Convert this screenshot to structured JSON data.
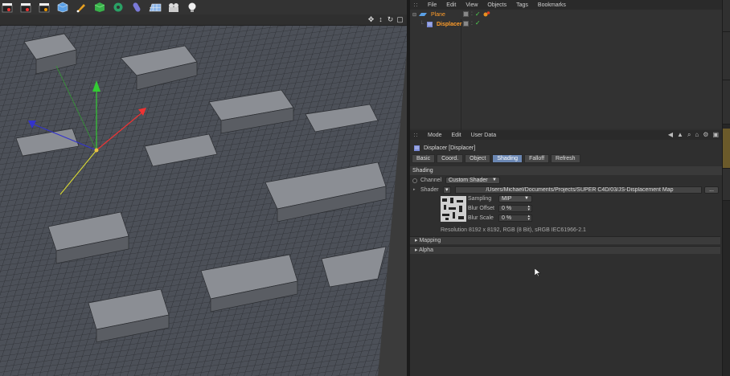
{
  "viewport": {
    "toolbar_icons": [
      "clapper-icon",
      "clapper-record-icon",
      "clapper-settings-icon",
      "cube-icon",
      "pen-icon",
      "cube-green-icon",
      "gear-green-icon",
      "capsule-icon",
      "grid-icon",
      "camera-icon",
      "light-icon"
    ],
    "nav_icons": [
      "move-icon",
      "zoom-icon",
      "rotate-icon",
      "maximize-icon"
    ]
  },
  "object_manager": {
    "menu": [
      "File",
      "Edit",
      "View",
      "Objects",
      "Tags",
      "Bookmarks"
    ],
    "objects": [
      {
        "name": "Plane",
        "level": 0
      },
      {
        "name": "Displacer",
        "level": 1
      }
    ]
  },
  "attribute_manager": {
    "menu": [
      "Mode",
      "Edit",
      "User Data"
    ],
    "title": "Displacer [Displacer]",
    "tabs": [
      {
        "label": "Basic",
        "active": false
      },
      {
        "label": "Coord.",
        "active": false
      },
      {
        "label": "Object",
        "active": false
      },
      {
        "label": "Shading",
        "active": true
      },
      {
        "label": "Falloff",
        "active": false
      },
      {
        "label": "Refresh",
        "active": false
      }
    ],
    "section": "Shading",
    "channel_label": "Channel",
    "channel_value": "Custom Shader",
    "shader_label": "Shader",
    "shader_path": "/Users/Michael/Documents/Projects/SUPER C4D/03/JS-Displacement Map",
    "shader_button": "...",
    "sampling_label": "Sampling",
    "sampling_value": "MIP",
    "blur_offset_label": "Blur Offset",
    "blur_offset_value": "0 %",
    "blur_scale_label": "Blur Scale",
    "blur_scale_value": "0 %",
    "resolution_text": "Resolution 8192 x 8192, RGB (8 Bit), sRGB IEC61966-2.1",
    "collapsed_sections": [
      "Mapping",
      "Alpha"
    ]
  },
  "accent_color": "#6b87b3",
  "object_name_color": "#ff9d2a"
}
